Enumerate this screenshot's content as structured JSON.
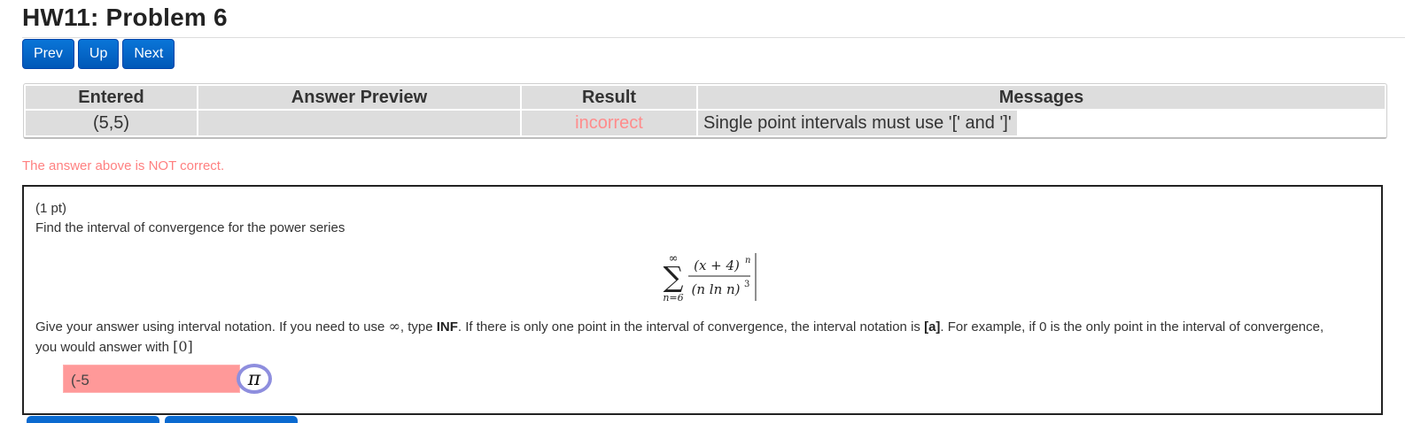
{
  "page": {
    "title": "HW11: Problem 6"
  },
  "nav": {
    "prev": "Prev",
    "up": "Up",
    "next": "Next"
  },
  "results_table": {
    "headers": [
      "Entered",
      "Answer Preview",
      "Result",
      "Messages"
    ],
    "rows": [
      {
        "entered": "(5,5)",
        "preview": "",
        "result": "incorrect",
        "message": "Single point intervals must use '[' and ']'"
      }
    ]
  },
  "feedback": {
    "status_text": "The answer above is NOT correct."
  },
  "problem": {
    "points": "(1 pt)",
    "prompt": "Find the interval of convergence for the power series",
    "formula": {
      "upper_limit": "∞",
      "sum_symbol": "∑",
      "lower_limit": "n=6",
      "numerator": "(x + 4)",
      "numerator_exp": "n",
      "denominator": "(n ln n)",
      "denominator_exp": "3"
    },
    "instructions": {
      "part1": "Give your answer using interval notation. If you need to use ",
      "infinity_symbol": "∞",
      "part2": ", type ",
      "inf_keyword": "INF",
      "part3": ". If there is only one point in the interval of convergence, the interval notation is ",
      "a_notation": "[a]",
      "part4": ". For example, if 0 is the only point in the interval of convergence, you would answer with ",
      "example": "[0]"
    },
    "answer": {
      "value": "(-5",
      "status": "incorrect"
    },
    "math_button": {
      "label": "π"
    }
  },
  "colors": {
    "nav_button": "#0a6ad0",
    "incorrect_text": "#ff8c8c",
    "incorrect_input": "#ff9999",
    "math_ring": "#8e8ede"
  }
}
